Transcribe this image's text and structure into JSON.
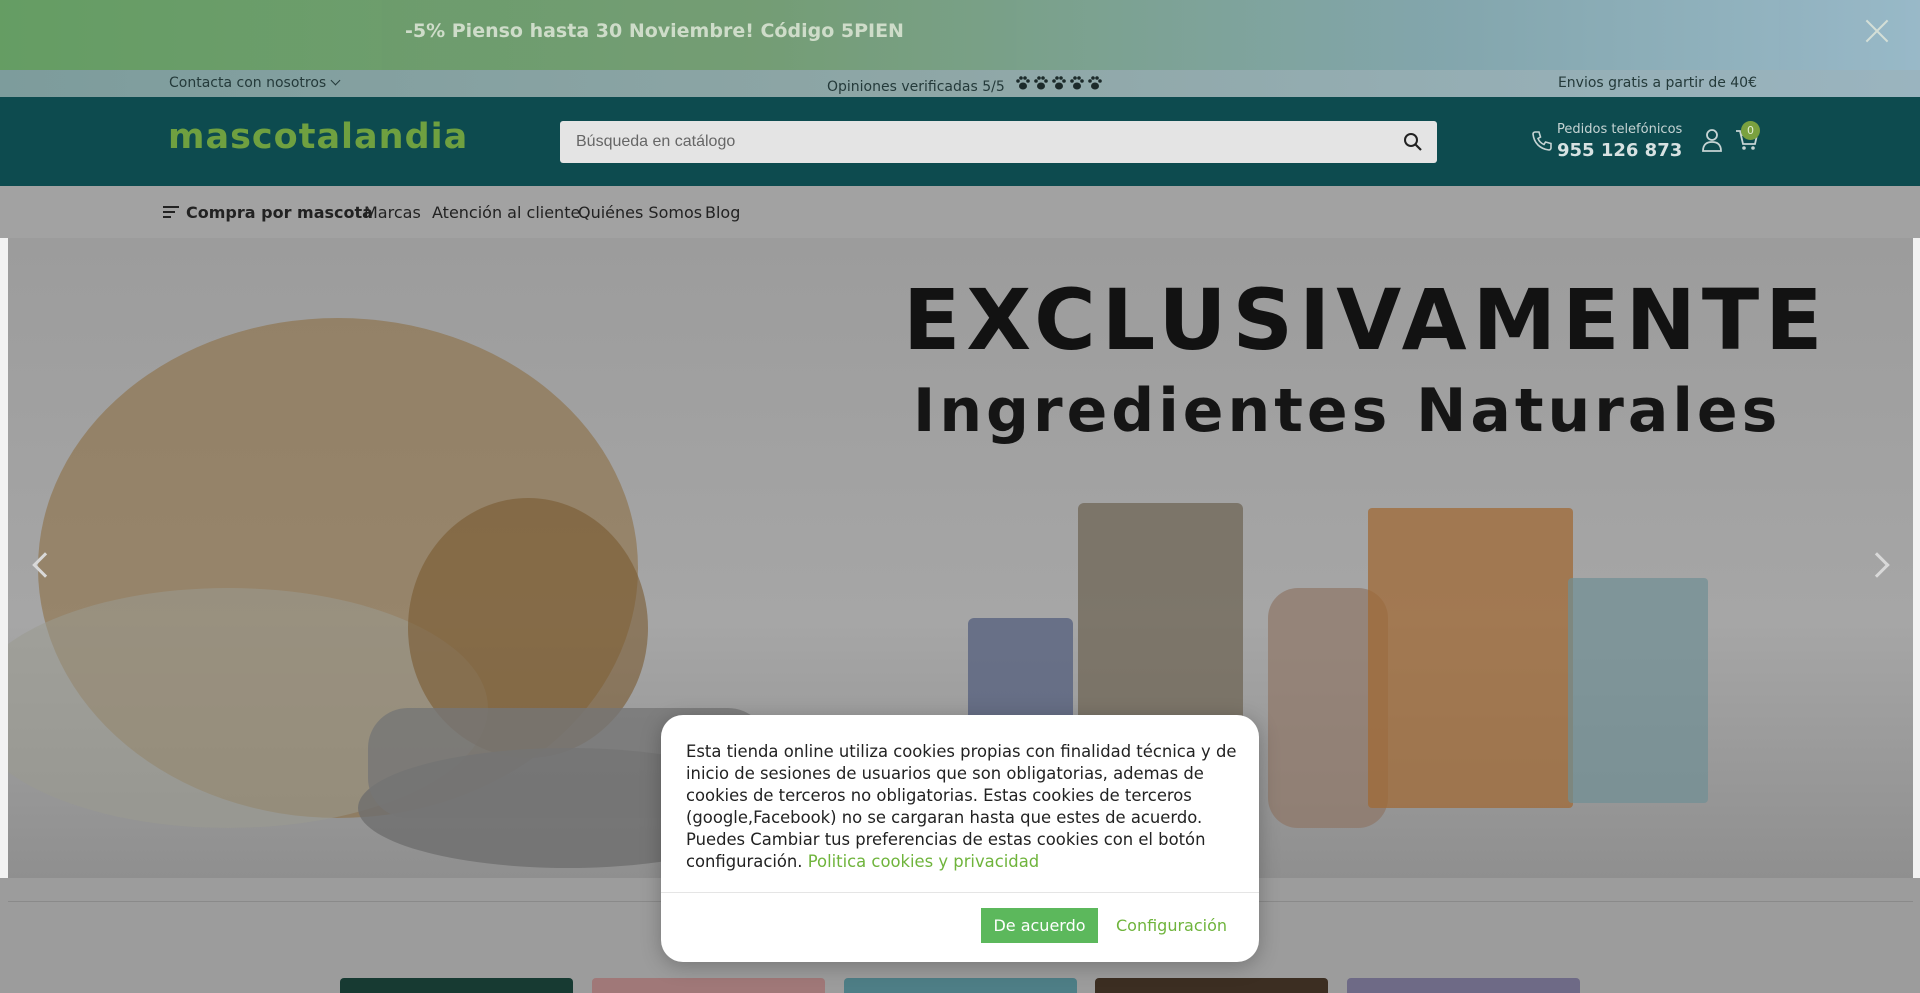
{
  "promo": {
    "text": "-5% Pienso hasta 30 Noviembre! Código 5PIEN",
    "close_icon": "close-icon"
  },
  "infobar": {
    "contact": "Contacta con nosotros",
    "reviews": "Opiniones verificadas 5/5",
    "reviews_rating": 5,
    "reviews_icon": "paw-icon",
    "shipping": "Envios gratis a partir de 40€"
  },
  "header": {
    "logo": "mascotalandia",
    "logo_color": "#6fa040",
    "search_placeholder": "Búsqueda en catálogo",
    "search_icon": "search-icon",
    "phone_label": "Pedidos telefónicos",
    "phone_number": "955 126 873",
    "cart_count": "0",
    "accent": "#0d4b4f"
  },
  "nav": {
    "shop_by_pet": "Compra por mascota",
    "items": [
      "Marcas",
      "Atención al cliente",
      "Quiénes Somos",
      "Blog"
    ]
  },
  "hero": {
    "title": "EXCLUSIVAMENTE",
    "subtitle": "Ingredientes Naturales"
  },
  "cookie": {
    "text": "Esta tienda online utiliza cookies propias con finalidad técnica y de inicio de sesiones de usuarios que son obligatorias, ademas de cookies de terceros no obligatorias. Estas cookies de terceros (google,Facebook) no se cargaran hasta que estes de acuerdo. Puedes Cambiar tus preferencias de estas cookies con el botón configuración.",
    "link": "Politica cookies y privacidad",
    "accept": "De acuerdo",
    "config": "Configuración",
    "link_color": "#6fb43c",
    "accept_color": "#5cb85c"
  }
}
